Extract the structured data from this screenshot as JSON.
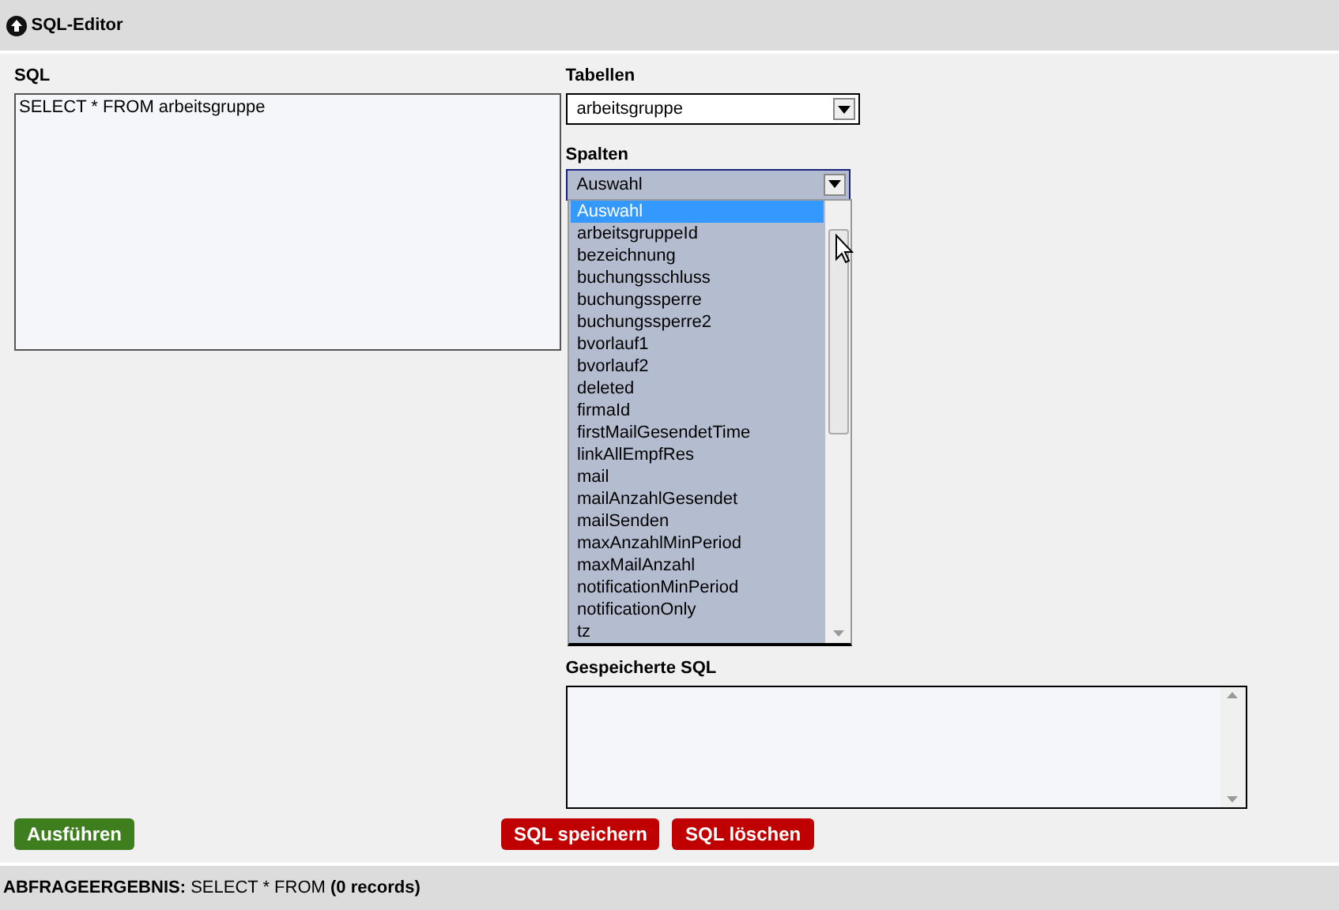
{
  "header": {
    "title": "SQL-Editor"
  },
  "sql": {
    "label": "SQL",
    "value": "SELECT * FROM arbeitsgruppe"
  },
  "tabellen": {
    "label": "Tabellen",
    "value": "arbeitsgruppe"
  },
  "spalten": {
    "label": "Spalten",
    "value": "Auswahl",
    "expanded": true,
    "options": [
      {
        "label": "Auswahl",
        "selected": true
      },
      {
        "label": "arbeitsgruppeId",
        "selected": false
      },
      {
        "label": "bezeichnung",
        "selected": false
      },
      {
        "label": "buchungsschluss",
        "selected": false
      },
      {
        "label": "buchungssperre",
        "selected": false
      },
      {
        "label": "buchungssperre2",
        "selected": false
      },
      {
        "label": "bvorlauf1",
        "selected": false
      },
      {
        "label": "bvorlauf2",
        "selected": false
      },
      {
        "label": "deleted",
        "selected": false
      },
      {
        "label": "firmaId",
        "selected": false
      },
      {
        "label": "firstMailGesendetTime",
        "selected": false
      },
      {
        "label": "linkAllEmpfRes",
        "selected": false
      },
      {
        "label": "mail",
        "selected": false
      },
      {
        "label": "mailAnzahlGesendet",
        "selected": false
      },
      {
        "label": "mailSenden",
        "selected": false
      },
      {
        "label": "maxAnzahlMinPeriod",
        "selected": false
      },
      {
        "label": "maxMailAnzahl",
        "selected": false
      },
      {
        "label": "notificationMinPeriod",
        "selected": false
      },
      {
        "label": "notificationOnly",
        "selected": false
      },
      {
        "label": "tz",
        "selected": false
      }
    ]
  },
  "saved": {
    "label": "Gespeicherte SQL"
  },
  "buttons": [
    {
      "label": "Ausführen",
      "kind": "run"
    },
    {
      "label": "SQL speichern",
      "kind": "danger"
    },
    {
      "label": "SQL löschen",
      "kind": "danger"
    }
  ],
  "result": {
    "text": "**ABFRAGEERGEBNIS:** SELECT * FROM **(0 records)**"
  }
}
